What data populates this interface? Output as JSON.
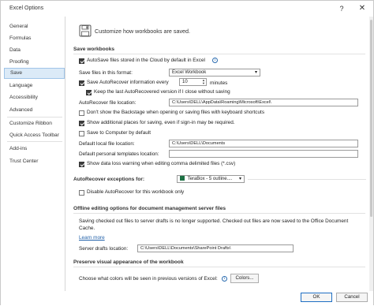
{
  "window": {
    "title": "Excel Options",
    "help_glyph": "?",
    "close_glyph": "✕"
  },
  "sidebar": {
    "items": [
      {
        "label": "General"
      },
      {
        "label": "Formulas"
      },
      {
        "label": "Data"
      },
      {
        "label": "Proofing"
      },
      {
        "label": "Save"
      },
      {
        "label": "Language"
      },
      {
        "label": "Accessibility"
      },
      {
        "label": "Advanced"
      },
      {
        "label": "Customize Ribbon"
      },
      {
        "label": "Quick Access Toolbar"
      },
      {
        "label": "Add-ins"
      },
      {
        "label": "Trust Center"
      }
    ]
  },
  "header": {
    "text": "Customize how workbooks are saved."
  },
  "save_workbooks": {
    "heading": "Save workbooks",
    "autosave_label": "AutoSave files stored in the Cloud by default in Excel",
    "save_format_label": "Save files in this format:",
    "save_format_value": "Excel Workbook",
    "autorecover_label": "Save AutoRecover information every",
    "autorecover_minutes": "10",
    "minutes_label": "minutes",
    "keep_last_label": "Keep the last AutoRecovered version if I close without saving",
    "autorecover_location_label": "AutoRecover file location:",
    "autorecover_location_value": "C:\\Users\\DELL\\AppData\\Roaming\\Microsoft\\Excel\\",
    "backstage_label": "Don't show the Backstage when opening or saving files with keyboard shortcuts",
    "additional_places_label": "Show additional places for saving, even if sign-in may be required.",
    "save_to_computer_label": "Save to Computer by default",
    "default_local_label": "Default local file location:",
    "default_local_value": "C:\\Users\\DELL\\Documents",
    "default_templates_label": "Default personal templates location:",
    "default_templates_value": "",
    "data_loss_label": "Show data loss warning when editing comma delimited files (*.csv)"
  },
  "autorecover_exceptions": {
    "label": "AutoRecover exceptions for:",
    "workbook_value": "TeraBox - 5 outline....",
    "disable_label": "Disable AutoRecover for this workbook only"
  },
  "offline": {
    "heading": "Offline editing options for document management server files",
    "description": "Saving checked out files to server drafts is no longer supported. Checked out files are now saved to the Office Document Cache.",
    "learn_more": "Learn more",
    "drafts_label": "Server drafts location:",
    "drafts_value": "C:\\Users\\DELL\\Documents\\SharePoint Drafts\\"
  },
  "preserve": {
    "heading": "Preserve visual appearance of the workbook",
    "colors_label": "Choose what colors will be seen in previous versions of Excel:",
    "colors_button": "Colors..."
  },
  "footer": {
    "ok": "OK",
    "cancel": "Cancel"
  },
  "checks": {
    "autosave": true,
    "autorecover": true,
    "keep_last": true,
    "backstage": false,
    "additional_places": true,
    "save_to_computer": false,
    "data_loss": true,
    "disable_autorecover": false
  },
  "colors": {
    "selected_nav_bg": "#dbeaf7",
    "accent": "#1f6fc4",
    "link": "#1f5fa8"
  }
}
